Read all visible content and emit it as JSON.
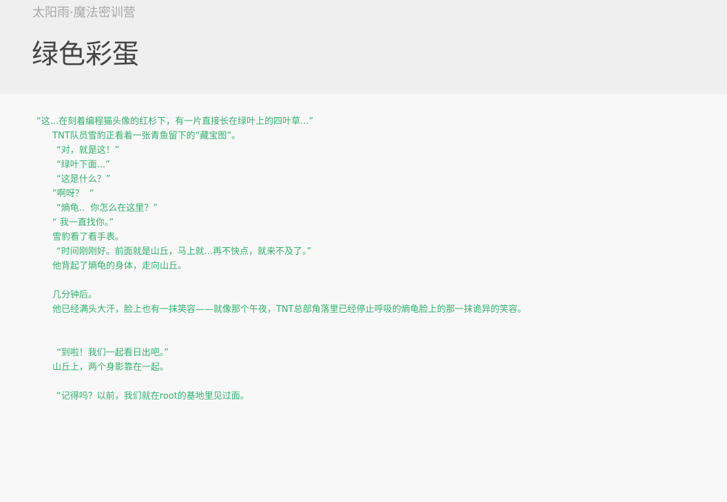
{
  "header": {
    "site_name": "太阳雨·魔法密训营",
    "title": "绿色彩蛋"
  },
  "story": {
    "lines": [
      {
        "text": "“这...在刻着编程猫头像的红杉下，有一片直接长在绿叶上的四叶草...”",
        "indent": 53
      },
      {
        "text": "TNT队员雪豹正看着一张青鱼留下的“藏宝图”。",
        "indent": 76
      },
      {
        "text": "“对，就是这！”",
        "indent": 82
      },
      {
        "text": "“绿叶下面...”",
        "indent": 82
      },
      {
        "text": "“这是什么？”",
        "indent": 82
      },
      {
        "text": "”啊呀？  ”",
        "indent": 76
      },
      {
        "text": "“熵龟..  你怎么在这里？”",
        "indent": 82
      },
      {
        "text": "“ 我一直找你。”",
        "indent": 76
      },
      {
        "text": "雪豹看了看手表。",
        "indent": 76
      },
      {
        "text": "“时间刚刚好。前面就是山丘，马上就...再不快点，就来不及了。”",
        "indent": 82
      },
      {
        "text": "他背起了熵龟的身体，走向山丘。",
        "indent": 76
      },
      {
        "text": "",
        "indent": 0
      },
      {
        "text": "几分钟后。",
        "indent": 76
      },
      {
        "text": "他已经满头大汗，脸上也有一抹笑容——就像那个午夜，TNT总部角落里已经停止呼吸的熵龟脸上的那一抹诡异的笑容。",
        "indent": 76
      },
      {
        "text": "",
        "indent": 0
      },
      {
        "text": "",
        "indent": 0
      },
      {
        "text": "“到啦！我们一起看日出吧。”",
        "indent": 82
      },
      {
        "text": "山丘上，两个身影靠在一起。",
        "indent": 76
      },
      {
        "text": "",
        "indent": 0
      },
      {
        "text": "“记得吗？以前，我们就在root的基地里见过面。",
        "indent": 82
      }
    ]
  },
  "colors": {
    "header_background": "#efefef",
    "page_background": "#f8f8f8",
    "site_name": "#a9a9a9",
    "title": "#444444",
    "story_text": "#33b06f"
  }
}
